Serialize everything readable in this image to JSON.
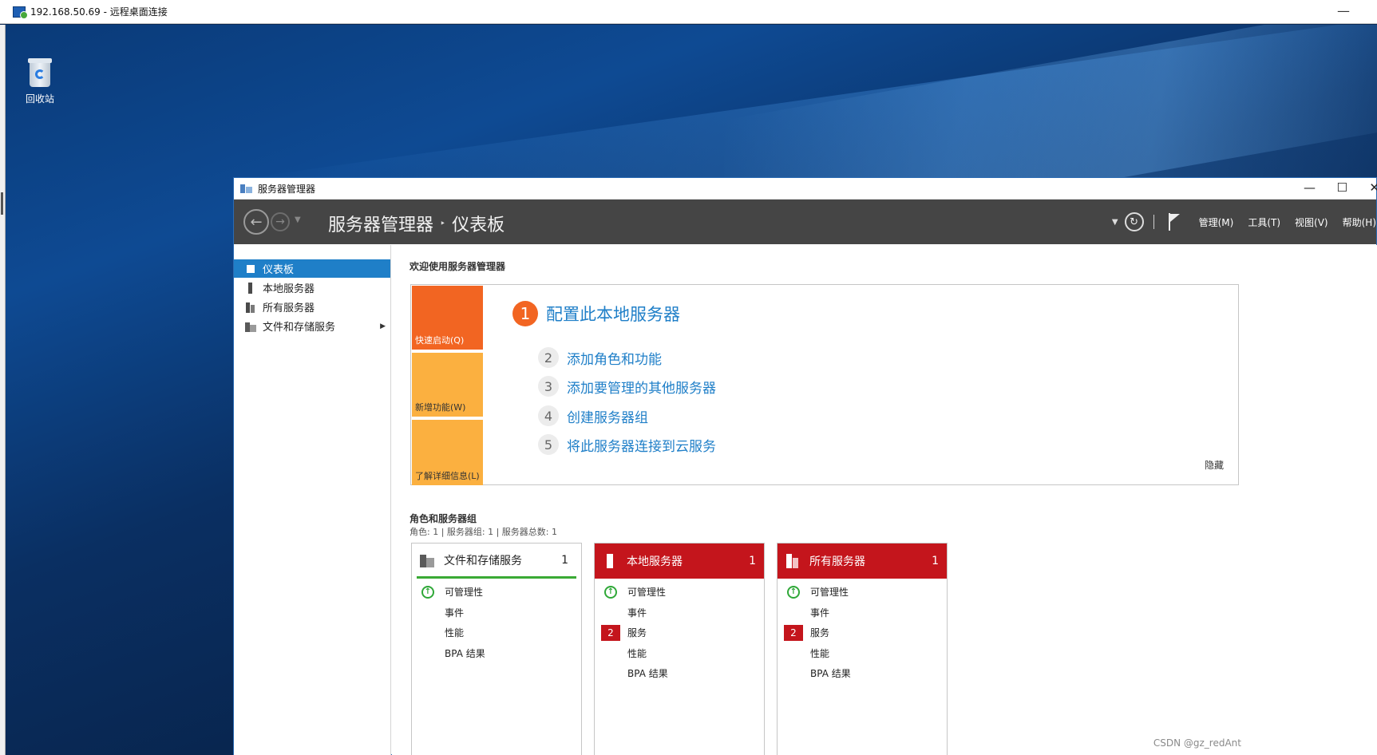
{
  "rdp": {
    "title": "192.168.50.69 - 远程桌面连接",
    "minimize": "—"
  },
  "desktop": {
    "recycle_bin_label": "回收站"
  },
  "window": {
    "title": "服务器管理器",
    "controls": {
      "minimize": "—",
      "maximize": "☐",
      "close": "✕"
    }
  },
  "header": {
    "breadcrumb_root": "服务器管理器",
    "breadcrumb_sep": "‣",
    "breadcrumb_current": "仪表板",
    "menus": [
      "管理(M)",
      "工具(T)",
      "视图(V)",
      "帮助(H)"
    ]
  },
  "sidebar": {
    "items": [
      {
        "label": "仪表板",
        "icon": "dashboard-icon",
        "active": true
      },
      {
        "label": "本地服务器",
        "icon": "server-icon"
      },
      {
        "label": "所有服务器",
        "icon": "servers-icon"
      },
      {
        "label": "文件和存储服务",
        "icon": "file-storage-icon",
        "has_submenu": true
      }
    ]
  },
  "main": {
    "welcome_title": "欢迎使用服务器管理器",
    "tiles": [
      "快速启动(Q)",
      "新增功能(W)",
      "了解详细信息(L)"
    ],
    "steps": [
      {
        "num": "1",
        "label": "配置此本地服务器"
      },
      {
        "num": "2",
        "label": "添加角色和功能"
      },
      {
        "num": "3",
        "label": "添加要管理的其他服务器"
      },
      {
        "num": "4",
        "label": "创建服务器组"
      },
      {
        "num": "5",
        "label": "将此服务器连接到云服务"
      }
    ],
    "hide_label": "隐藏",
    "roles_title": "角色和服务器组",
    "roles_summary": "角色: 1 | 服务器组: 1 | 服务器总数: 1",
    "cards": [
      {
        "title": "文件和存储服务",
        "count": "1",
        "status": "normal",
        "rows": [
          {
            "label": "可管理性",
            "marker": "ok"
          },
          {
            "label": "事件"
          },
          {
            "label": "性能"
          },
          {
            "label": "BPA 结果"
          }
        ]
      },
      {
        "title": "本地服务器",
        "count": "1",
        "status": "alert",
        "rows": [
          {
            "label": "可管理性",
            "marker": "ok"
          },
          {
            "label": "事件"
          },
          {
            "label": "服务",
            "badge": "2"
          },
          {
            "label": "性能"
          },
          {
            "label": "BPA 结果"
          }
        ]
      },
      {
        "title": "所有服务器",
        "count": "1",
        "status": "alert",
        "rows": [
          {
            "label": "可管理性",
            "marker": "ok"
          },
          {
            "label": "事件"
          },
          {
            "label": "服务",
            "badge": "2"
          },
          {
            "label": "性能"
          },
          {
            "label": "BPA 结果"
          }
        ]
      }
    ]
  },
  "colors": {
    "header_bg": "#454545",
    "accent_blue": "#1f7fc8",
    "quickstart_orange": "#f26522",
    "tile_yellow": "#fbb040",
    "alert_red": "#c4151c",
    "ok_green": "#2fa838"
  },
  "watermark": "CSDN @gz_redAnt"
}
